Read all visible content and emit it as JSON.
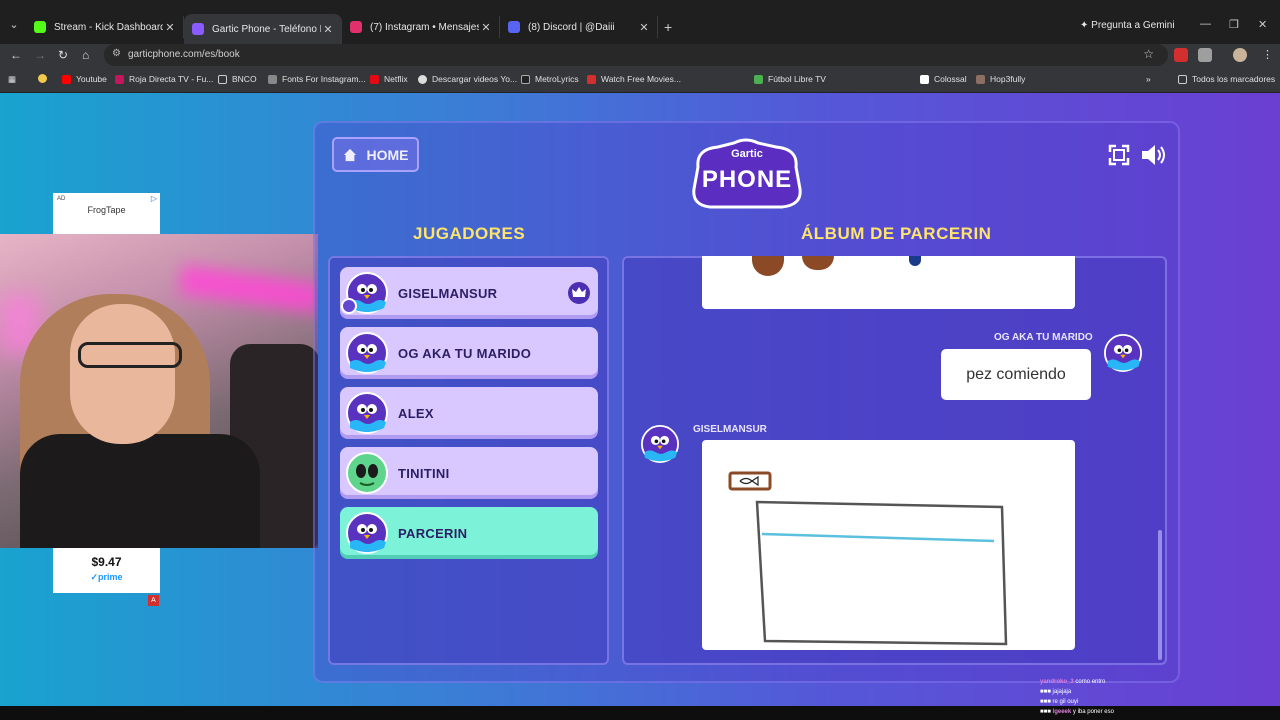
{
  "browser": {
    "tabs": [
      {
        "title": "Stream - Kick Dashboard",
        "color": "#53fc18"
      },
      {
        "title": "Gartic Phone - Teléfono Descon",
        "color": "#8a5cff"
      },
      {
        "title": "(7) Instagram • Mensajes",
        "color": "#e1306c"
      },
      {
        "title": "(8) Discord | @Daiii",
        "color": "#5865f2"
      }
    ],
    "gemini_label": "Pregunta a Gemini",
    "url": "garticphone.com/es/book",
    "bookmarks": [
      "Youtube",
      "Roja Directa TV - Fu...",
      "BNCO",
      "Fonts For Instagram...",
      "Netflix",
      "Descargar videos Yo...",
      "MetroLyrics",
      "Watch Free Movies...",
      "Fútbol Libre TV",
      "Colossal",
      "Hop3fully"
    ],
    "all_bookmarks": "Todos los marcadores"
  },
  "ad": {
    "tag": "AD",
    "brand": "FrogTape",
    "price": "$9.47",
    "prime": "✓prime",
    "badge": "A"
  },
  "game": {
    "home_label": "HOME",
    "logo_sub": "Gartic",
    "logo_main": "PHONE",
    "players_heading": "JUGADORES",
    "album_heading": "ÁLBUM DE PARCERIN",
    "players": [
      {
        "name": "GISELMANSUR",
        "avatar": "purple-bird",
        "host": true
      },
      {
        "name": "OG AKA TU MARIDO",
        "avatar": "purple-bird"
      },
      {
        "name": "ALEX",
        "avatar": "purple-bird"
      },
      {
        "name": "TINITINI",
        "avatar": "green-alien"
      },
      {
        "name": "PARCERIN",
        "avatar": "purple-bird",
        "active": true
      }
    ],
    "album": {
      "entry1_author": "OG AKA TU MARIDO",
      "entry1_text": "pez comiendo",
      "entry2_author": "GISELMANSUR"
    },
    "colors": {
      "heading": "#ffe46b",
      "active_player": "#7cf3d8",
      "player": "#d8c8ff"
    }
  },
  "stream_chat": [
    {
      "user": "yandroko_3",
      "msg": "como entro"
    },
    {
      "user": "",
      "msg": "jajajaja"
    },
    {
      "user": "",
      "msg": "re gil ouyi"
    },
    {
      "user": "lgeeek",
      "msg": "y iba poner eso"
    }
  ]
}
